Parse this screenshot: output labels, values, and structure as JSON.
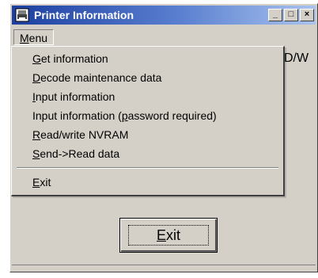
{
  "window": {
    "title": "Printer Information",
    "buttons": {
      "minimize": "_",
      "maximize": "□",
      "close": "×"
    }
  },
  "menubar": {
    "menu_label_u": "M",
    "menu_label_rest": "enu"
  },
  "background": {
    "partial_text": "D/W"
  },
  "menu": {
    "items": [
      {
        "u": "G",
        "rest": "et information"
      },
      {
        "u": "D",
        "rest": "ecode maintenance data"
      },
      {
        "u": "I",
        "rest": "nput information"
      },
      {
        "pre": "Input information (",
        "u": "p",
        "rest": "assword required)"
      },
      {
        "u": "R",
        "rest": "ead/write NVRAM"
      },
      {
        "u": "S",
        "rest": "end->Read data"
      }
    ],
    "exit": {
      "u": "E",
      "rest": "xit"
    }
  },
  "exit_button": {
    "u": "E",
    "rest": "xit"
  },
  "colors": {
    "titlebar_start": "#1c3fa0",
    "titlebar_end": "#a9c3ee",
    "face": "#d4d0c8"
  },
  "icons": [
    "printer-app-icon",
    "minimize-icon",
    "maximize-icon",
    "close-icon"
  ]
}
